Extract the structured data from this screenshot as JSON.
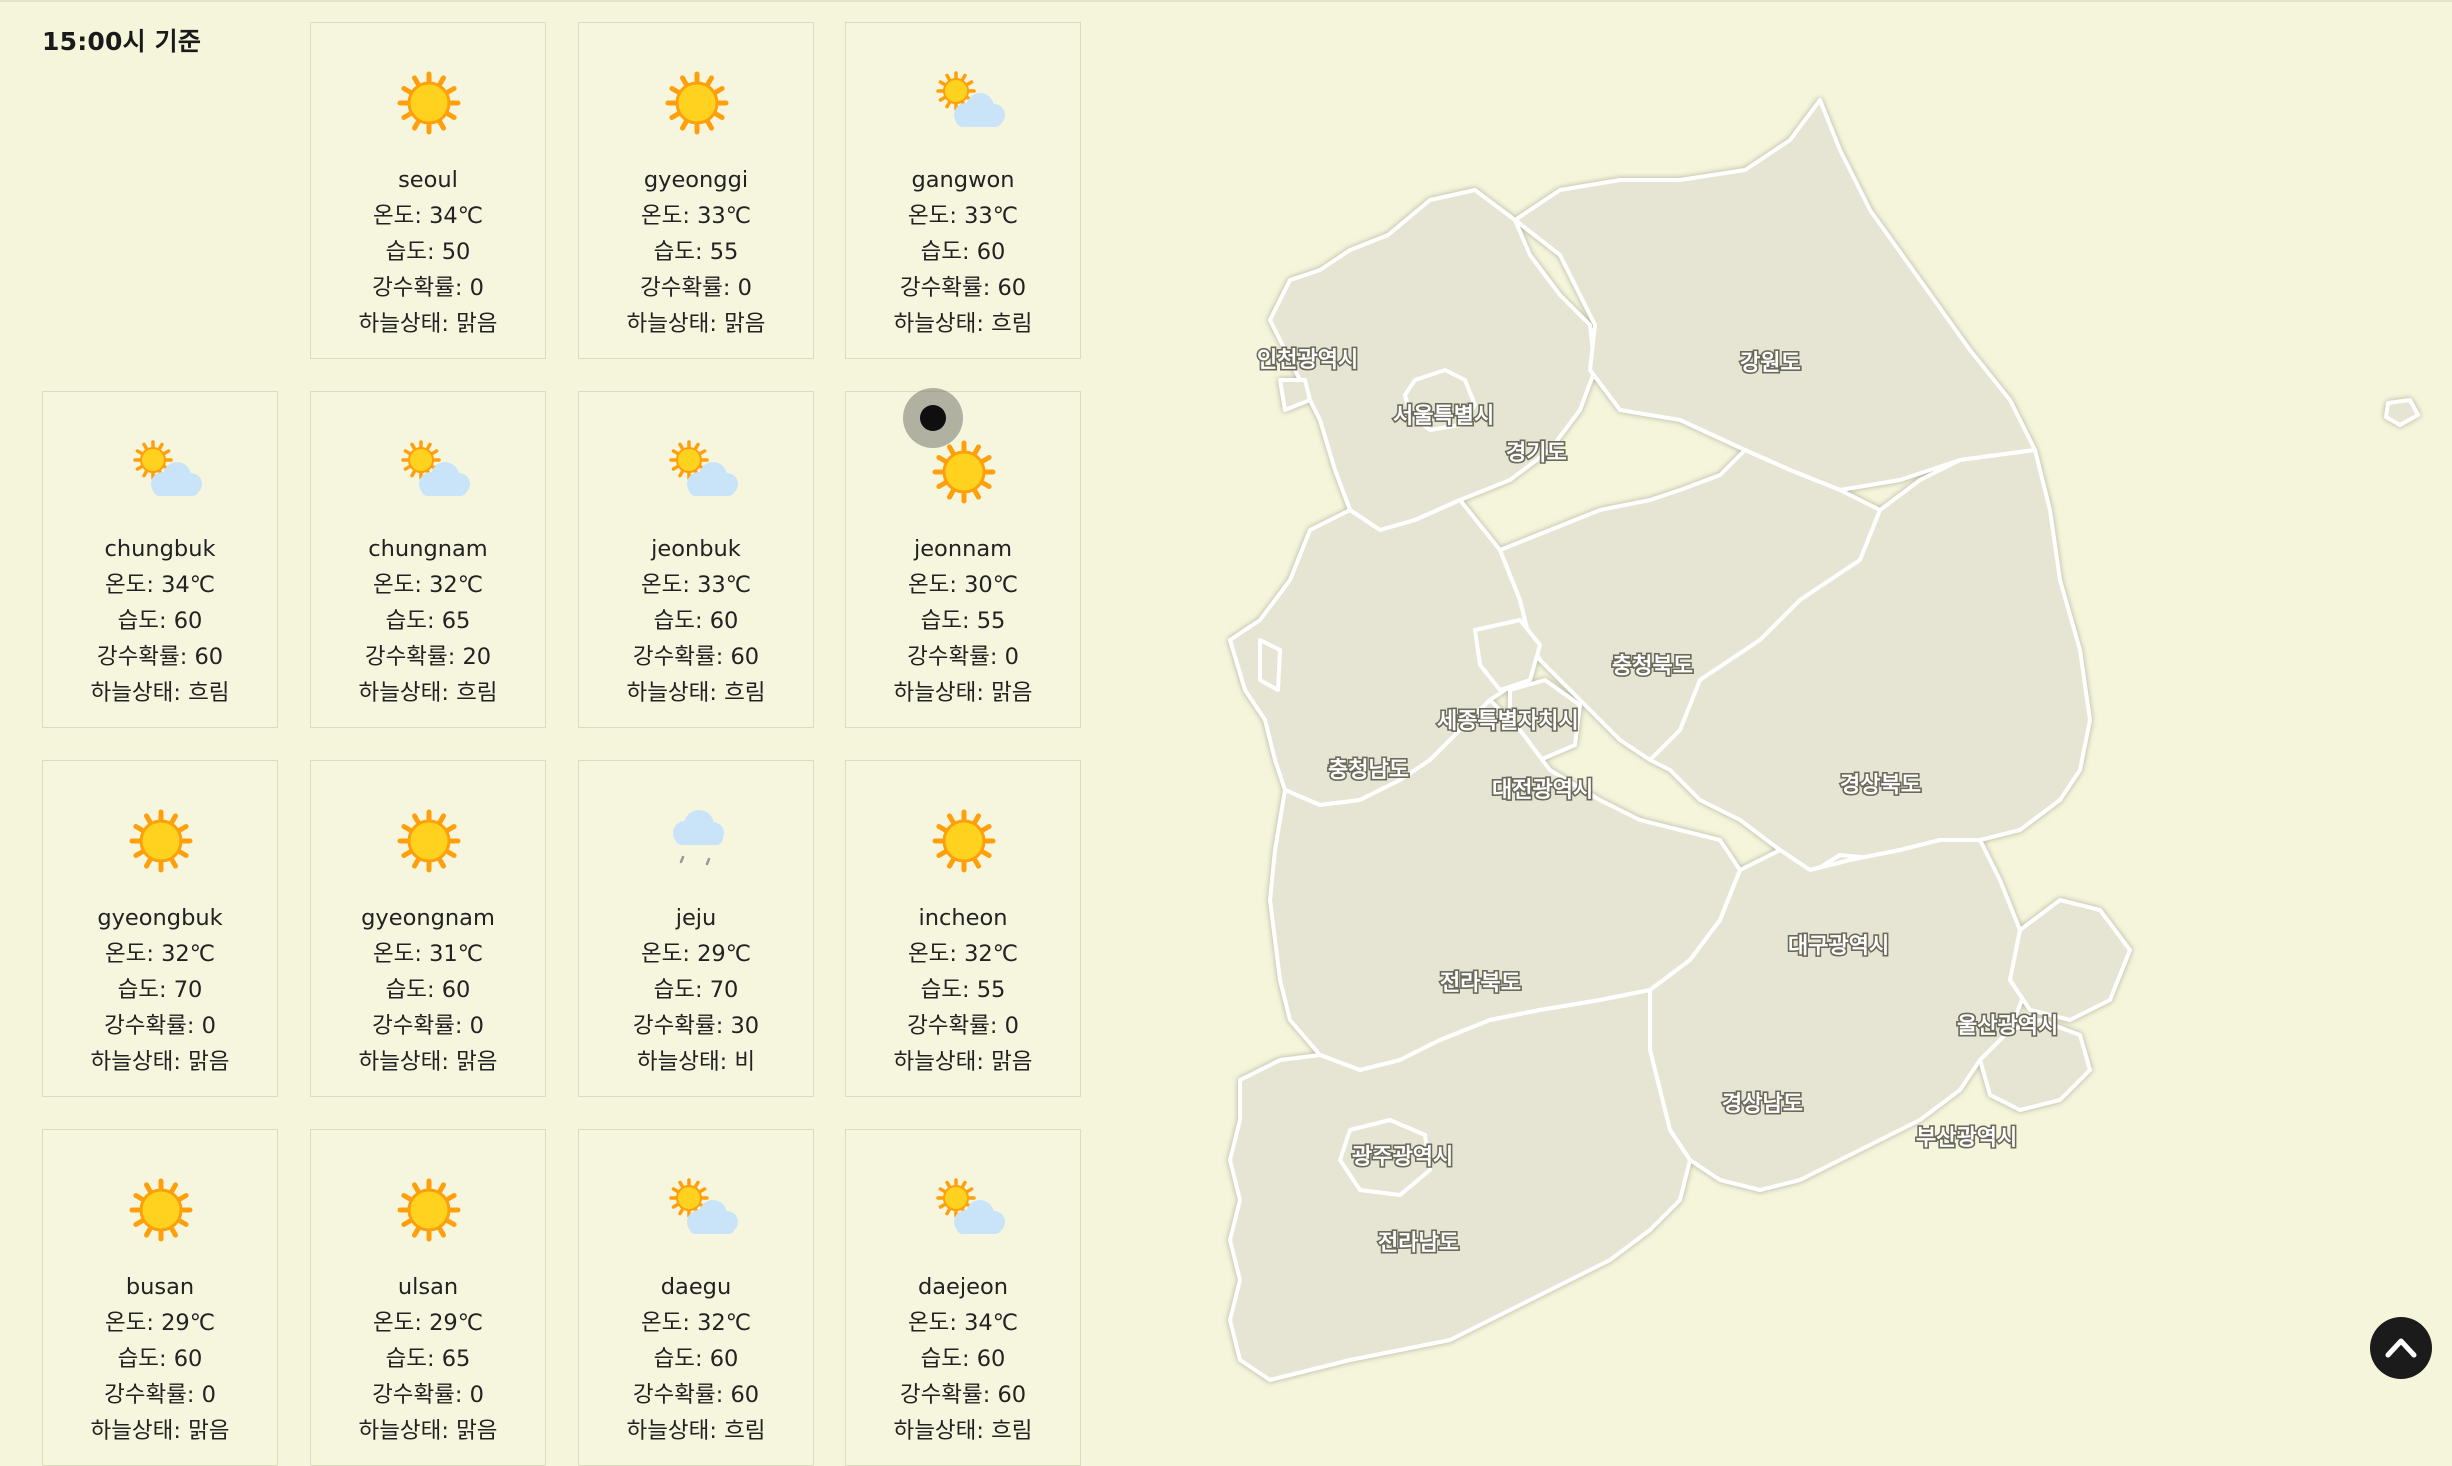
{
  "header": {
    "time_label": "15:00시 기준"
  },
  "labels": {
    "temp": "온도",
    "humidity": "습도",
    "rain": "강수확률",
    "sky": "하늘상태"
  },
  "cards": [
    {
      "name": "seoul",
      "temp": "34℃",
      "humidity": "50",
      "rain": "0",
      "sky": "맑음",
      "icon": "sun-icon"
    },
    {
      "name": "gyeonggi",
      "temp": "33℃",
      "humidity": "55",
      "rain": "0",
      "sky": "맑음",
      "icon": "sun-icon"
    },
    {
      "name": "gangwon",
      "temp": "33℃",
      "humidity": "60",
      "rain": "60",
      "sky": "흐림",
      "icon": "partly-cloudy-icon"
    },
    {
      "name": "chungbuk",
      "temp": "34℃",
      "humidity": "60",
      "rain": "60",
      "sky": "흐림",
      "icon": "partly-cloudy-icon"
    },
    {
      "name": "chungnam",
      "temp": "32℃",
      "humidity": "65",
      "rain": "20",
      "sky": "흐림",
      "icon": "partly-cloudy-icon"
    },
    {
      "name": "jeonbuk",
      "temp": "33℃",
      "humidity": "60",
      "rain": "60",
      "sky": "흐림",
      "icon": "partly-cloudy-icon"
    },
    {
      "name": "jeonnam",
      "temp": "30℃",
      "humidity": "55",
      "rain": "0",
      "sky": "맑음",
      "icon": "sun-icon"
    },
    {
      "name": "gyeongbuk",
      "temp": "32℃",
      "humidity": "70",
      "rain": "0",
      "sky": "맑음",
      "icon": "sun-icon"
    },
    {
      "name": "gyeongnam",
      "temp": "31℃",
      "humidity": "60",
      "rain": "0",
      "sky": "맑음",
      "icon": "sun-icon"
    },
    {
      "name": "jeju",
      "temp": "29℃",
      "humidity": "70",
      "rain": "30",
      "sky": "비",
      "icon": "rain-cloud-icon"
    },
    {
      "name": "incheon",
      "temp": "32℃",
      "humidity": "55",
      "rain": "0",
      "sky": "맑음",
      "icon": "sun-icon"
    },
    {
      "name": "busan",
      "temp": "29℃",
      "humidity": "60",
      "rain": "0",
      "sky": "맑음",
      "icon": "sun-icon"
    },
    {
      "name": "ulsan",
      "temp": "29℃",
      "humidity": "65",
      "rain": "0",
      "sky": "맑음",
      "icon": "sun-icon"
    },
    {
      "name": "daegu",
      "temp": "32℃",
      "humidity": "60",
      "rain": "60",
      "sky": "흐림",
      "icon": "partly-cloudy-icon"
    },
    {
      "name": "daejeon",
      "temp": "34℃",
      "humidity": "60",
      "rain": "60",
      "sky": "흐림",
      "icon": "partly-cloudy-icon"
    }
  ],
  "map": {
    "regions": {
      "incheon": "인천광역시",
      "seoul": "서울특별시",
      "gyeonggi": "경기도",
      "gangwon": "강원도",
      "chungbuk": "충청북도",
      "sejong": "세종특별자치시",
      "chungnam": "충청남도",
      "daejeon": "대전광역시",
      "gyeongbuk": "경상북도",
      "daegu": "대구광역시",
      "jeonbuk": "전라북도",
      "ulsan": "울산광역시",
      "gyeongnam": "경상남도",
      "busan": "부산광역시",
      "gwangju": "광주광역시",
      "jeonnam": "전라남도"
    }
  },
  "colors": {
    "background": "#f5f5dc",
    "map_fill": "#e6e5d3",
    "sun": "#ffd21f",
    "sun_ray": "#ff9f0a",
    "cloud": "#c9e3f8"
  }
}
